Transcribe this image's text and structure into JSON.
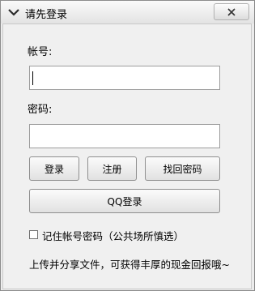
{
  "window": {
    "title": "请先登录"
  },
  "form": {
    "account_label": "帐号:",
    "account_value": "",
    "password_label": "密码:",
    "password_value": ""
  },
  "buttons": {
    "login": "登录",
    "register": "注册",
    "recover": "找回密码",
    "qq_login": "QQ登录"
  },
  "remember": {
    "label": "记住帐号密码（公共场所慎选）",
    "checked": false
  },
  "footer_text": "上传并分享文件，可获得丰厚的现金回报哦~"
}
